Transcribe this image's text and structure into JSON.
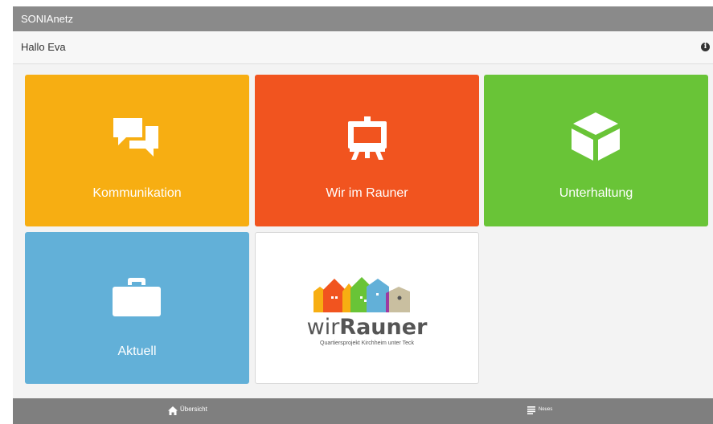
{
  "app": {
    "title": "SONIAnetz"
  },
  "header": {
    "greeting": "Hallo Eva",
    "info_icon": "info-icon"
  },
  "tiles": [
    {
      "label": "Kommunikation",
      "icon": "chat-bubbles-icon",
      "color": "#f7ae12"
    },
    {
      "label": "Wir im Rauner",
      "icon": "easel-icon",
      "color": "#f1541f"
    },
    {
      "label": "Unterhaltung",
      "icon": "cube-icon",
      "color": "#69c437"
    },
    {
      "label": "Aktuell",
      "icon": "briefcase-icon",
      "color": "#62b0d8"
    }
  ],
  "logo_tile": {
    "name_prefix": "wir",
    "name_main": "Rauner",
    "subtitle": "Quartiersprojekt Kirchheim unter Teck"
  },
  "navbar": {
    "items": [
      {
        "label": "Übersicht",
        "icon": "home-icon"
      },
      {
        "label": "Neues",
        "icon": "list-icon"
      }
    ]
  }
}
